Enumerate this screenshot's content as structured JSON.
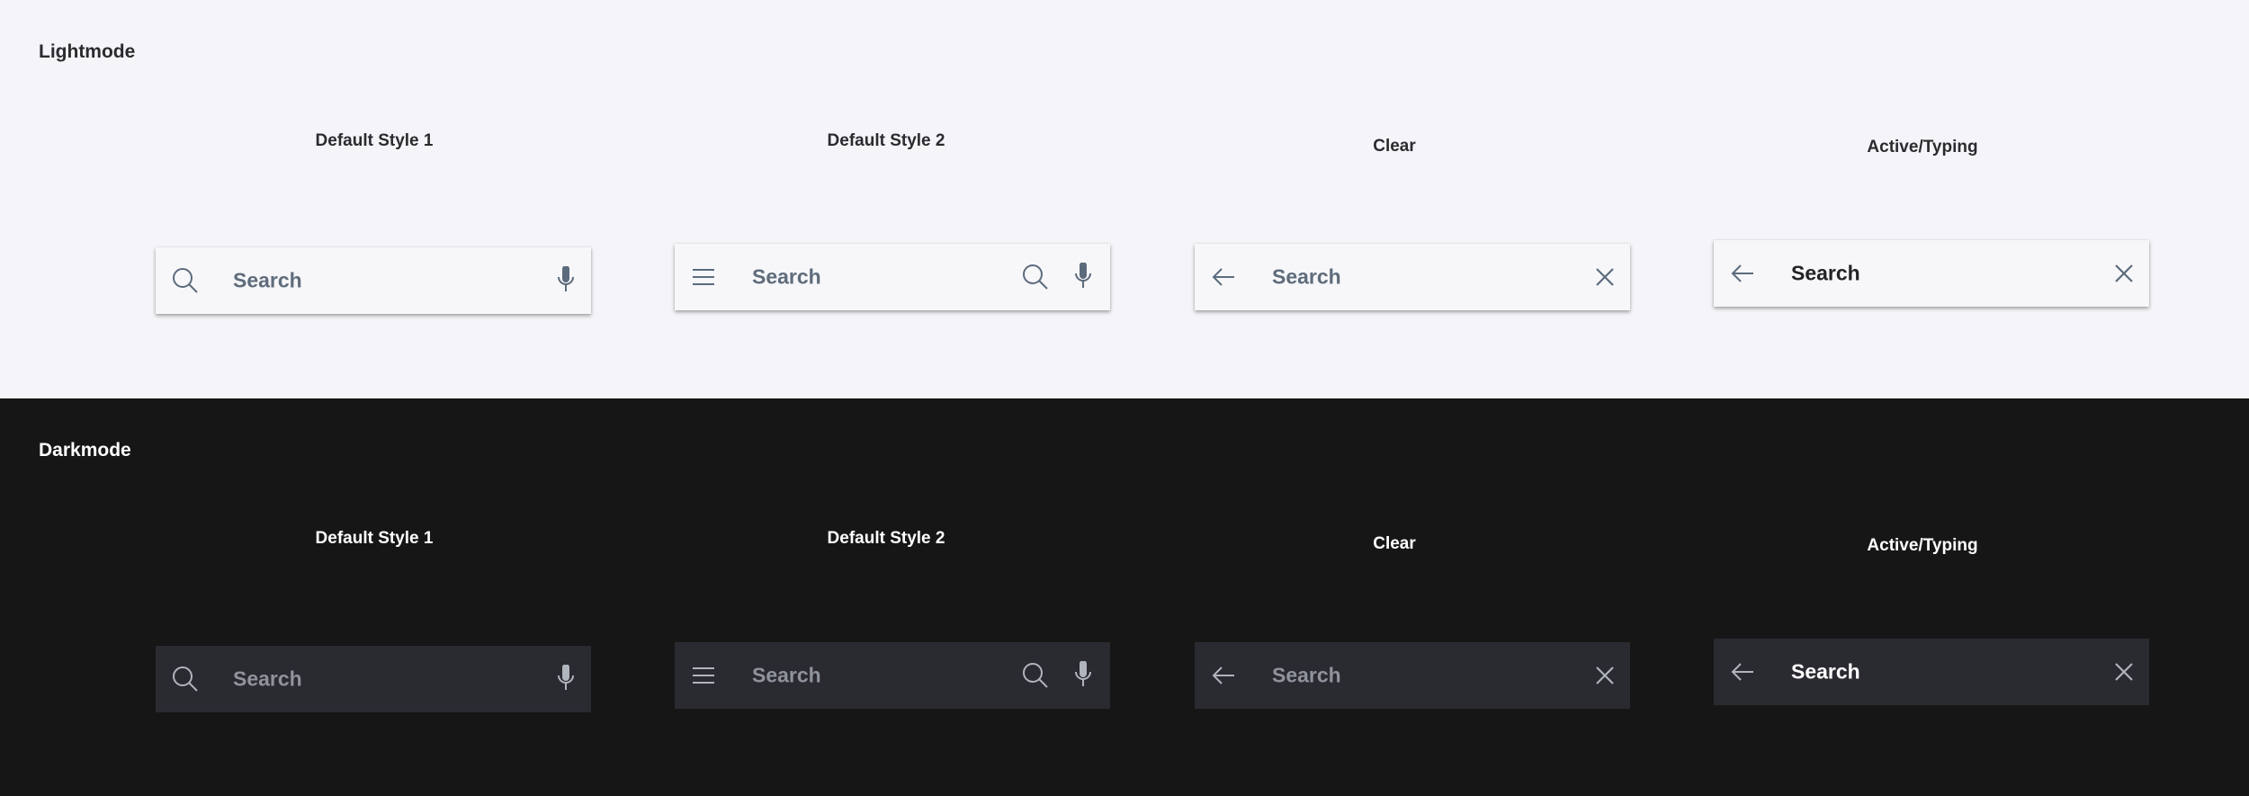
{
  "light": {
    "title": "Lightmode",
    "variants": [
      {
        "label": "Default Style 1",
        "placeholder": "Search"
      },
      {
        "label": "Default Style 2",
        "placeholder": "Search"
      },
      {
        "label": "Clear",
        "placeholder": "Search"
      },
      {
        "label": "Active/Typing",
        "value": "Search"
      }
    ]
  },
  "dark": {
    "title": "Darkmode",
    "variants": [
      {
        "label": "Default Style 1",
        "placeholder": "Search"
      },
      {
        "label": "Default Style 2",
        "placeholder": "Search"
      },
      {
        "label": "Clear",
        "placeholder": "Search"
      },
      {
        "label": "Active/Typing",
        "value": "Search"
      }
    ]
  },
  "icons": [
    "search-icon",
    "microphone-icon",
    "menu-icon",
    "arrow-left-icon",
    "close-icon"
  ],
  "colors": {
    "light_background": "#f5f5f9",
    "dark_background": "#161617",
    "light_bar": "#f7f7fa",
    "dark_bar": "#2a2a31",
    "light_placeholder": "#5f6c7b",
    "dark_placeholder": "#8f939c"
  }
}
